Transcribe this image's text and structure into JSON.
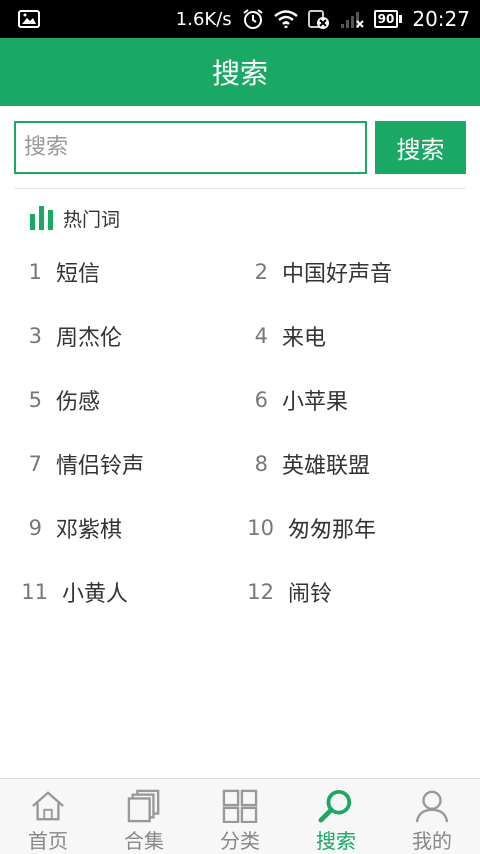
{
  "status_bar": {
    "speed": "1.6K/s",
    "battery": "90",
    "time": "20:27",
    "icons": [
      "image-icon",
      "alarm-icon",
      "wifi-icon",
      "sim-icon",
      "signal-icon",
      "battery-icon"
    ]
  },
  "header": {
    "title": "搜索"
  },
  "search": {
    "placeholder": "搜索",
    "button_label": "搜索"
  },
  "hot": {
    "title": "热门词",
    "items": [
      {
        "num": "1",
        "text": "短信"
      },
      {
        "num": "2",
        "text": "中国好声音"
      },
      {
        "num": "3",
        "text": "周杰伦"
      },
      {
        "num": "4",
        "text": "来电"
      },
      {
        "num": "5",
        "text": "伤感"
      },
      {
        "num": "6",
        "text": "小苹果"
      },
      {
        "num": "7",
        "text": "情侣铃声"
      },
      {
        "num": "8",
        "text": "英雄联盟"
      },
      {
        "num": "9",
        "text": "邓紫棋"
      },
      {
        "num": "10",
        "text": "匆匆那年"
      },
      {
        "num": "11",
        "text": "小黄人"
      },
      {
        "num": "12",
        "text": "闹铃"
      }
    ]
  },
  "tabs": [
    {
      "label": "首页",
      "icon": "home-icon"
    },
    {
      "label": "合集",
      "icon": "collection-icon"
    },
    {
      "label": "分类",
      "icon": "grid-icon"
    },
    {
      "label": "搜索",
      "icon": "search-icon",
      "active": true
    },
    {
      "label": "我的",
      "icon": "user-icon"
    }
  ],
  "colors": {
    "accent": "#1aa865",
    "status_bar": "#000000"
  }
}
